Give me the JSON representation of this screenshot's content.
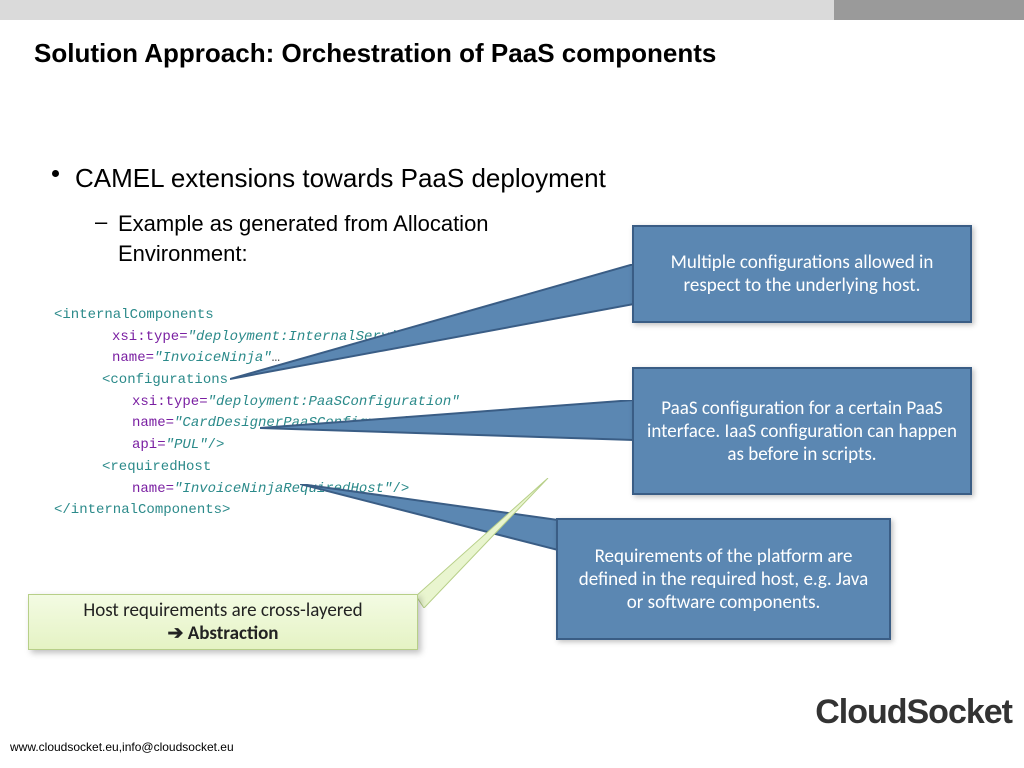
{
  "title": "Solution Approach: Orchestration of PaaS components",
  "bullet1": "CAMEL extensions towards PaaS deployment",
  "bullet2": "Example as generated from Allocation Environment:",
  "xml": {
    "open_internal": "<internalComponents",
    "internal_xsi_attr": "xsi:type",
    "internal_xsi_val": "\"deployment:InternalServiceC",
    "internal_name_attr": "name",
    "internal_name_val": "\"InvoiceNinja\"",
    "ellipsis": "…",
    "open_conf": "<configurations",
    "conf_xsi_attr": "xsi:type",
    "conf_xsi_val": "\"deployment:PaaSConfiguration\"",
    "conf_name_attr": "name",
    "conf_name_val": "\"CardDesignerPaaSConfiguration\"",
    "conf_api_attr": "api",
    "conf_api_val": "\"PUL\"",
    "selfclose": "/>",
    "open_req": "<requiredHost",
    "req_name_attr": "name",
    "req_name_val": "\"InvoiceNinjaRequiredHost\"",
    "close_internal": "</internalComponents>"
  },
  "callouts": {
    "c1": "Multiple configurations allowed in respect to the underlying host.",
    "c2": "PaaS configuration for a certain PaaS interface. IaaS configuration can happen as before in scripts.",
    "c3": "Requirements of the platform are defined in the required host, e.g. Java or software components."
  },
  "greenbox": {
    "line1": "Host requirements are cross-layered",
    "arrow": "➔",
    "line2": "Abstraction"
  },
  "greentail_target": "requiredHost",
  "logo": "CloudSocket",
  "footer": "www.cloudsocket.eu,info@cloudsocket.eu"
}
